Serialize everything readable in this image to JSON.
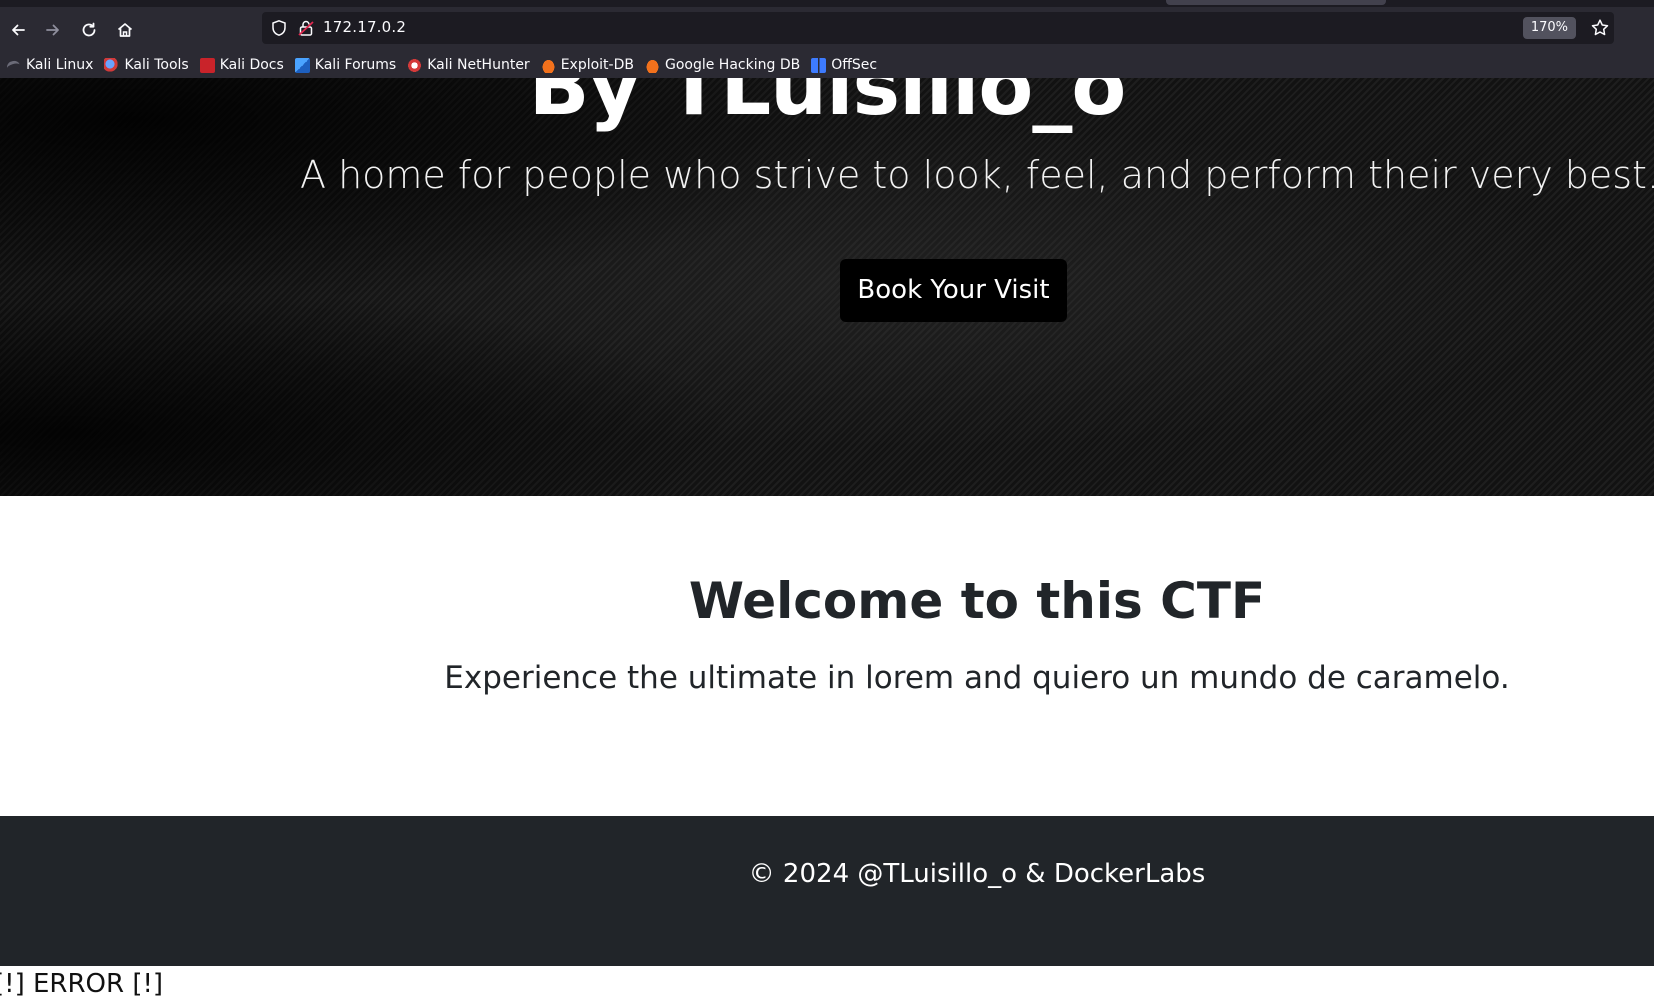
{
  "browser": {
    "url": "172.17.0.2",
    "zoom": "170%",
    "bookmarks": [
      {
        "label": "Kali Linux",
        "icon": "kali-dragon-icon"
      },
      {
        "label": "Kali Tools",
        "icon": "kali-tools-icon"
      },
      {
        "label": "Kali Docs",
        "icon": "kali-docs-icon"
      },
      {
        "label": "Kali Forums",
        "icon": "kali-forums-icon"
      },
      {
        "label": "Kali NetHunter",
        "icon": "kali-nethunter-icon"
      },
      {
        "label": "Exploit-DB",
        "icon": "exploit-db-icon"
      },
      {
        "label": "Google Hacking DB",
        "icon": "ghdb-icon"
      },
      {
        "label": "OffSec",
        "icon": "offsec-icon"
      }
    ]
  },
  "hero": {
    "title": "By TLuisillo_o",
    "subtitle": "A home for people who strive to look, feel, and perform their very best.",
    "cta_label": "Book Your Visit"
  },
  "welcome": {
    "heading": "Welcome to this CTF",
    "text": "Experience the ultimate in lorem and quiero un mundo de caramelo."
  },
  "footer": {
    "copyright": "© 2024 @TLuisillo_o & DockerLabs"
  },
  "error": "[!] ERROR [!]",
  "colors": {
    "chrome_bg": "#2b2a33",
    "urlbar_bg": "#1c1b22",
    "footer_bg": "#212529",
    "button_bg": "#000000",
    "text_dark": "#212529"
  }
}
